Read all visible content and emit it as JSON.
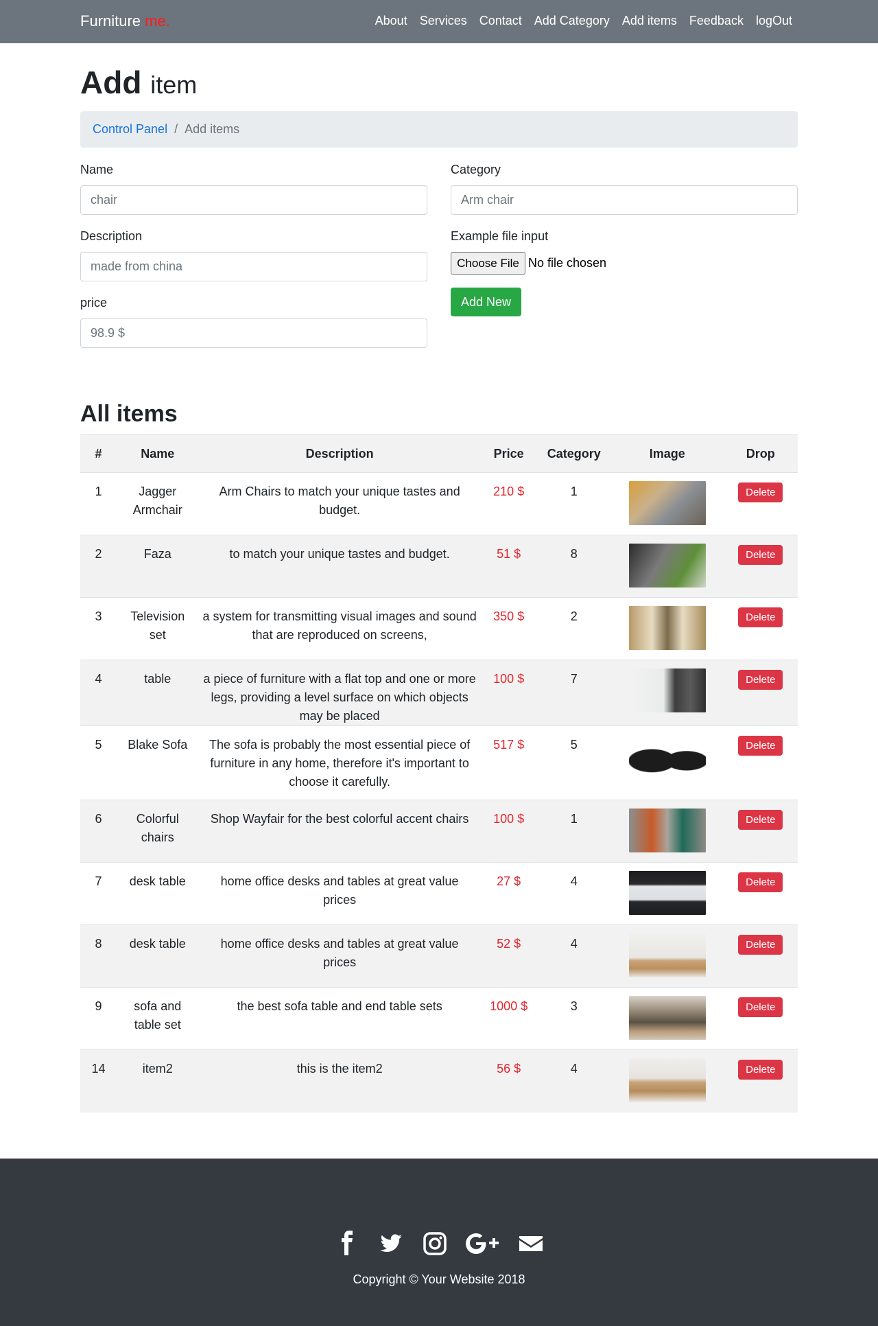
{
  "navbar": {
    "brand_main": "Furniture",
    "brand_accent": "me.",
    "links": [
      "About",
      "Services",
      "Contact",
      "Add Category",
      "Add items",
      "Feedback",
      "logOut"
    ]
  },
  "header": {
    "title": "Add",
    "title_small": "item",
    "breadcrumb": {
      "home": "Control Panel",
      "current": "Add items"
    }
  },
  "form": {
    "name_label": "Name",
    "name_placeholder": "chair",
    "description_label": "Description",
    "description_placeholder": "made from china",
    "price_label": "price",
    "price_placeholder": "98.9 $",
    "category_label": "Category",
    "category_placeholder": "Arm chair",
    "file_label": "Example file input",
    "file_button": "Choose File",
    "file_status": "No file chosen",
    "submit_label": "Add New"
  },
  "table": {
    "title": "All items",
    "headers": [
      "#",
      "Name",
      "Description",
      "Price",
      "Category",
      "Image",
      "Drop"
    ],
    "delete_label": "Delete",
    "rows": [
      {
        "id": "1",
        "name": "Jagger Armchair",
        "description": "Arm Chairs to match your unique tastes and budget.",
        "price": "210 $",
        "category": "1",
        "image": "armchairs-thumbnail"
      },
      {
        "id": "2",
        "name": "Faza",
        "description": "to match your unique tastes and budget.",
        "price": "51 $",
        "category": "8",
        "image": "pillows-thumbnail"
      },
      {
        "id": "3",
        "name": "Television set",
        "description": "a system for transmitting visual images and sound that are reproduced on screens,",
        "price": "350 $",
        "category": "2",
        "image": "tv-stand-thumbnail"
      },
      {
        "id": "4",
        "name": "table",
        "description": "a piece of furniture with a flat top and one or more legs, providing a level surface on which objects may be placed",
        "price": "100 $",
        "category": "7",
        "image": "shelf-thumbnail"
      },
      {
        "id": "5",
        "name": "Blake Sofa",
        "description": "The sofa is probably the most essential piece of furniture in any home, therefore it's important to choose it carefully.",
        "price": "517 $",
        "category": "5",
        "image": "black-sofa-thumbnail"
      },
      {
        "id": "6",
        "name": "Colorful chairs",
        "description": "Shop Wayfair for the best colorful accent chairs",
        "price": "100 $",
        "category": "1",
        "image": "colorful-chairs-thumbnail"
      },
      {
        "id": "7",
        "name": "desk table",
        "description": "home office desks and tables at great value prices",
        "price": "27 $",
        "category": "4",
        "image": "office-desk-thumbnail"
      },
      {
        "id": "8",
        "name": "desk table",
        "description": "home office desks and tables at great value prices",
        "price": "52 $",
        "category": "4",
        "image": "desk-lamp-thumbnail"
      },
      {
        "id": "9",
        "name": "sofa and table set",
        "description": "the best sofa table and end table sets",
        "price": "1000 $",
        "category": "3",
        "image": "living-room-thumbnail"
      },
      {
        "id": "14",
        "name": "item2",
        "description": "this is the item2",
        "price": "56 $",
        "category": "4",
        "image": "wooden-desk-thumbnail"
      }
    ]
  },
  "footer": {
    "icons": [
      "facebook-icon",
      "twitter-icon",
      "instagram-icon",
      "google-plus-icon",
      "envelope-icon"
    ],
    "copyright": "Copyright © Your Website 2018"
  },
  "colors": {
    "navbar_bg": "#6c757d",
    "brand_accent": "#ff1a1a",
    "link": "#1a73d9",
    "success": "#28a745",
    "danger": "#dc3545",
    "price": "#e3262f",
    "footer_bg": "#343a40"
  }
}
